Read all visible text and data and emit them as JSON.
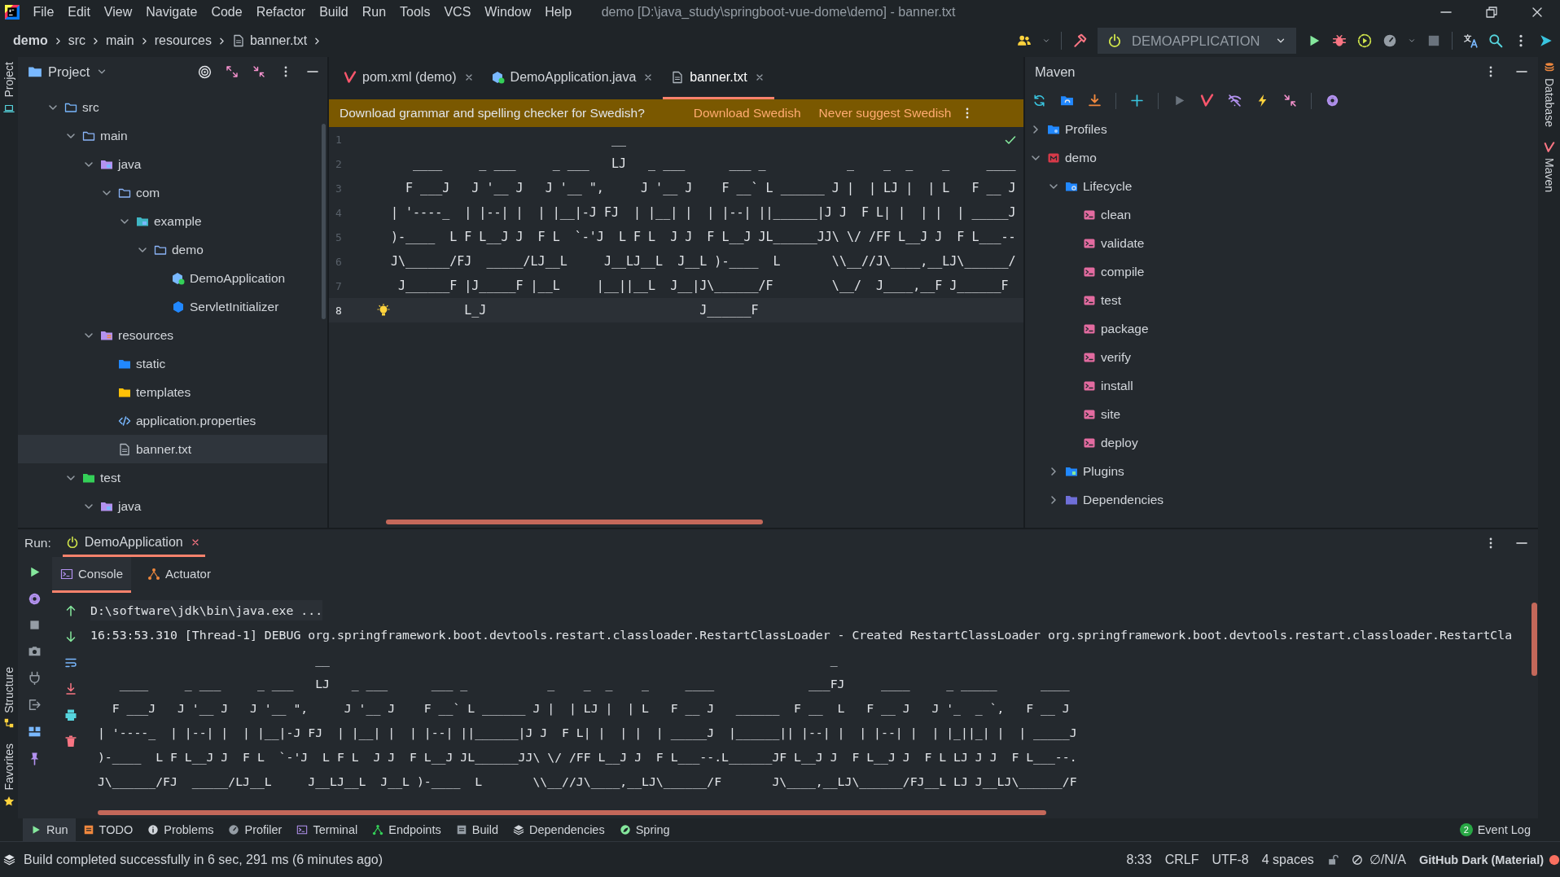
{
  "window": {
    "title": "demo [D:\\java_study\\springboot-vue-dome\\demo] - banner.txt"
  },
  "menu": [
    "File",
    "Edit",
    "View",
    "Navigate",
    "Code",
    "Refactor",
    "Build",
    "Run",
    "Tools",
    "VCS",
    "Window",
    "Help"
  ],
  "breadcrumbs": [
    "demo",
    "src",
    "main",
    "resources",
    "banner.txt"
  ],
  "run_configuration": {
    "label": "DEMOAPPLICATION"
  },
  "left_stripe": [
    "Project",
    "Structure",
    "Favorites"
  ],
  "right_stripe": [
    "Database",
    "Maven"
  ],
  "project": {
    "title": "Project",
    "tree": [
      {
        "label": "src",
        "kind": "source-folder",
        "expanded": true,
        "selected": false,
        "children": [
          {
            "label": "main",
            "kind": "folder",
            "expanded": true,
            "selected": false,
            "children": [
              {
                "label": "java",
                "kind": "source-root",
                "expanded": true,
                "selected": false,
                "children": [
                  {
                    "label": "com",
                    "kind": "folder",
                    "expanded": true,
                    "selected": false,
                    "children": [
                      {
                        "label": "example",
                        "kind": "package",
                        "expanded": true,
                        "selected": false,
                        "children": [
                          {
                            "label": "demo",
                            "kind": "folder",
                            "expanded": true,
                            "selected": false,
                            "children": [
                              {
                                "label": "DemoApplication",
                                "kind": "spring-class",
                                "selected": false
                              },
                              {
                                "label": "ServletInitializer",
                                "kind": "class",
                                "selected": false
                              }
                            ]
                          }
                        ]
                      }
                    ]
                  }
                ]
              },
              {
                "label": "resources",
                "kind": "resources-root",
                "expanded": true,
                "selected": false,
                "children": [
                  {
                    "label": "static",
                    "kind": "web-folder",
                    "selected": false
                  },
                  {
                    "label": "templates",
                    "kind": "template-folder",
                    "selected": false
                  },
                  {
                    "label": "application.properties",
                    "kind": "properties",
                    "selected": false
                  },
                  {
                    "label": "banner.txt",
                    "kind": "text-file",
                    "selected": true
                  }
                ]
              }
            ]
          },
          {
            "label": "test",
            "kind": "test-root",
            "expanded": true,
            "selected": false,
            "children": [
              {
                "label": "java",
                "kind": "source-root",
                "expanded": true,
                "selected": false
              }
            ]
          }
        ]
      }
    ]
  },
  "editor": {
    "tabs": [
      {
        "label": "pom.xml (demo)",
        "kind": "maven",
        "selected": false
      },
      {
        "label": "DemoApplication.java",
        "kind": "spring-class",
        "selected": false
      },
      {
        "label": "banner.txt",
        "kind": "text",
        "selected": true
      }
    ],
    "notification": {
      "text": "Download grammar and spelling checker for Swedish?",
      "actions": [
        "Download Swedish",
        "Never suggest Swedish"
      ]
    },
    "lines": [
      {
        "number": "1",
        "text": "                              __",
        "current": false
      },
      {
        "number": "2",
        "text": "   ____     _ ___     _ ___   LJ   _ ___      ___ _           _    _  _    _     ____",
        "current": false
      },
      {
        "number": "3",
        "text": "  F ___J   J '__ J   J '__ \",     J '__ J    F __` L ______ J |  | LJ |  | L   F __ J",
        "current": false
      },
      {
        "number": "4",
        "text": "| '----_  | |--| |  | |__|-J FJ  | |__| |  | |--| ||______|J J  F L| |  | |  | _____J",
        "current": false
      },
      {
        "number": "5",
        "text": ")-____  L F L__J J  F L  `-'J  L F L  J J  F L__J JL______JJ\\ \\/ /FF L__J J  F L___--",
        "current": false
      },
      {
        "number": "6",
        "text": "J\\______/FJ  _____/LJ__L     J__LJ__L  J__L )-____  L       \\\\__//J\\____,__LJ\\______/",
        "current": false
      },
      {
        "number": "7",
        "text": " J______F |J_____F |__L     |__||__L  J__|J\\______/F        \\__/  J____,__F J______F",
        "current": false
      },
      {
        "number": "8",
        "text": "          L_J                             J______F",
        "current": true
      }
    ]
  },
  "maven": {
    "title": "Maven",
    "tree": [
      {
        "label": "Profiles",
        "kind": "profiles",
        "expanded": false,
        "selected": false
      },
      {
        "label": "demo",
        "kind": "module",
        "expanded": true,
        "selected": false,
        "children": [
          {
            "label": "Lifecycle",
            "kind": "lifecycle",
            "expanded": true,
            "selected": false,
            "children": [
              {
                "label": "clean",
                "kind": "goal",
                "selected": false
              },
              {
                "label": "validate",
                "kind": "goal",
                "selected": false
              },
              {
                "label": "compile",
                "kind": "goal",
                "selected": false
              },
              {
                "label": "test",
                "kind": "goal",
                "selected": false
              },
              {
                "label": "package",
                "kind": "goal",
                "selected": false
              },
              {
                "label": "verify",
                "kind": "goal",
                "selected": false
              },
              {
                "label": "install",
                "kind": "goal",
                "selected": false
              },
              {
                "label": "site",
                "kind": "goal",
                "selected": false
              },
              {
                "label": "deploy",
                "kind": "goal",
                "selected": false
              }
            ]
          },
          {
            "label": "Plugins",
            "kind": "plugins",
            "expanded": false,
            "selected": false
          },
          {
            "label": "Dependencies",
            "kind": "dependencies",
            "expanded": false,
            "selected": false
          }
        ]
      }
    ]
  },
  "run": {
    "label": "Run:",
    "tabs": [
      {
        "label": "DemoApplication",
        "selected": true
      }
    ],
    "console_tabs": [
      {
        "label": "Console",
        "kind": "console",
        "selected": true
      },
      {
        "label": "Actuator",
        "kind": "actuator",
        "selected": false
      }
    ],
    "lines": [
      {
        "kind": "command",
        "text": "D:\\software\\jdk\\bin\\java.exe ..."
      },
      {
        "kind": "log",
        "text": "16:53:53.310 [Thread-1] DEBUG org.springframework.boot.devtools.restart.classloader.RestartClassLoader - Created RestartClassLoader org.springframework.boot.devtools.restart.classloader.RestartCla"
      },
      {
        "kind": "art",
        "text": "                               __                                                                     _"
      },
      {
        "kind": "art",
        "text": "    ____     _ ___     _ ___   LJ   _ ___      ___ _           _    _  _    _     ____             ___FJ     ____     _ _____      ____"
      },
      {
        "kind": "art",
        "text": "   F ___J   J '__ J   J '__ \",     J '__ J    F __` L ______ J |  | LJ |  | L   F __ J   ______  F __  L   F __ J   J '_  _ `,   F __ J"
      },
      {
        "kind": "art",
        "text": " | '----_  | |--| |  | |__|-J FJ  | |__| |  | |--| ||______|J J  F L| |  | |  | _____J  |______|| |--| |  | |--| |  | |_||_| |  | _____J"
      },
      {
        "kind": "art",
        "text": " )-____  L F L__J J  F L  `-'J  L F L  J J  F L__J JL______JJ\\ \\/ /FF L__J J  F L___--.L______JF L__J J  F L__J J  F L LJ J J  F L___--."
      },
      {
        "kind": "art",
        "text": " J\\______/FJ  _____/LJ__L     J__LJ__L  J__L )-____  L       \\\\__//J\\____,__LJ\\______/F       J\\____,__LJ\\______/FJ__L LJ J__LJ\\______/F"
      }
    ]
  },
  "tool_windows": [
    {
      "label": "Run",
      "kind": "run",
      "selected": true
    },
    {
      "label": "TODO",
      "kind": "todo",
      "selected": false
    },
    {
      "label": "Problems",
      "kind": "problems",
      "selected": false
    },
    {
      "label": "Profiler",
      "kind": "profiler",
      "selected": false
    },
    {
      "label": "Terminal",
      "kind": "terminal",
      "selected": false
    },
    {
      "label": "Endpoints",
      "kind": "endpoints",
      "selected": false
    },
    {
      "label": "Build",
      "kind": "build",
      "selected": false
    },
    {
      "label": "Dependencies",
      "kind": "dependencies",
      "selected": false
    },
    {
      "label": "Spring",
      "kind": "spring",
      "selected": false
    }
  ],
  "event_log": {
    "label": "Event Log",
    "count": "2"
  },
  "status_bar": {
    "message": "Build completed successfully in 6 sec, 291 ms (6 minutes ago)",
    "items": [
      "8:33",
      "CRLF",
      "UTF-8",
      "4 spaces"
    ],
    "vcs": "∅/N/A",
    "theme": "GitHub Dark (Material)"
  }
}
